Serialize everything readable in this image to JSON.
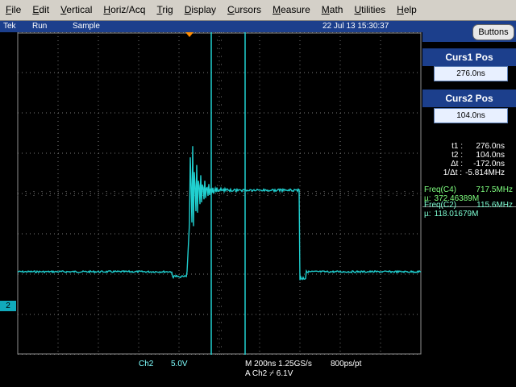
{
  "menu": [
    "File",
    "Edit",
    "Vertical",
    "Horiz/Acq",
    "Trig",
    "Display",
    "Cursors",
    "Measure",
    "Math",
    "Utilities",
    "Help"
  ],
  "status": {
    "brand": "Tek",
    "mode": "Run",
    "acq": "Sample",
    "datetime": "22 Jul 13 15:30:37"
  },
  "buttons_label": "Buttons",
  "curs1": {
    "title": "Curs1 Pos",
    "value": "276.0ns"
  },
  "curs2": {
    "title": "Curs2 Pos",
    "value": "104.0ns"
  },
  "readout": [
    {
      "label": "t1 :",
      "value": "276.0ns"
    },
    {
      "label": "t2 :",
      "value": "104.0ns"
    },
    {
      "label": "Δt :",
      "value": "-172.0ns"
    },
    {
      "label": "1/Δt :",
      "value": "-5.814MHz"
    }
  ],
  "freq_c4": {
    "name": "Freq(C4)",
    "value": "717.5MHz",
    "mu_label": "µ:",
    "mu_value": "372.46389M"
  },
  "freq_c2": {
    "name": "Freq(C2)",
    "value": "115.6MHz",
    "mu_label": "µ:",
    "mu_value": "118.01679M"
  },
  "bottom": {
    "ch": "Ch2",
    "volts": "5.0V",
    "timebase": "M 200ns 1.25GS/s",
    "pts": "800ps/pt",
    "trigger": "A  Ch2  ⌿  6.1V"
  },
  "ch_marker": "2",
  "colors": {
    "trace": "#20d0d0",
    "cursor": "#20d0d0",
    "grid": "#808080"
  }
}
